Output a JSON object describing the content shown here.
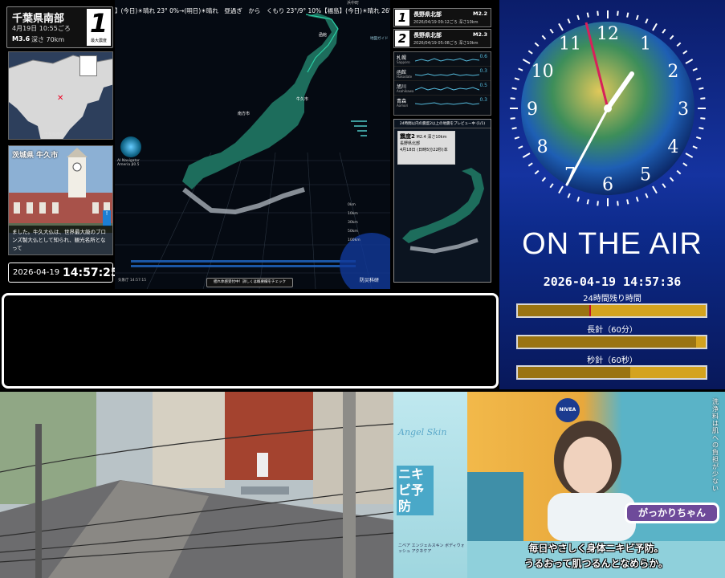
{
  "quake_head": {
    "place": "千葉県南部",
    "time": "4月19日 10:55ごろ",
    "magnitude": "M3.6",
    "depth": "深さ 70km",
    "shindo": "1",
    "shindo_label": "最大震度"
  },
  "mini_map": {
    "label": "千葉県南部"
  },
  "city_card": {
    "title": "茨城県 牛久市",
    "caption": "ました。牛久大仏は、世界最大級のブロンズ製大仏として知られ、観光名所となって"
  },
  "local_clock": {
    "date": "2026-04-19",
    "time": "14:57:25"
  },
  "map": {
    "ticker": "】(今日)☀晴れ 23° 0%→(明日)☀晴れ　昼過ぎ　から　くもり 23°/9° 10%【福島】(今日)☀晴れ 26° 0%",
    "tiny_top": "浜中町",
    "ai_nav": "AI Navigator Ameria β0.5",
    "city_tags": [
      "函館",
      "南方市",
      "牛久市"
    ],
    "depth_scale": [
      "0km",
      "10km",
      "30km",
      "50km",
      "100km"
    ],
    "side_legend": "地図ガイド",
    "note": "揺れ体感受付中！詳しくは概要欄をチェック",
    "hypo_small": "気象庁 14:57:15",
    "bosai": "防災科研"
  },
  "recent": [
    {
      "rank": "1",
      "name": "長野県北部",
      "mag": "M2.2",
      "sub": "2026/04/19 09:12ごろ 深さ10km"
    },
    {
      "rank": "2",
      "name": "長野県北部",
      "mag": "M2.3",
      "sub": "2026/04/19 05:08ごろ 深さ10km"
    }
  ],
  "graphs": [
    {
      "name": "札幌",
      "en": "Sapporo",
      "value": "0.6"
    },
    {
      "name": "函館",
      "en": "Hakodate",
      "value": "0.3"
    },
    {
      "name": "旭川",
      "en": "Asahikawa",
      "value": "0.5"
    },
    {
      "name": "青森",
      "en": "Aomori",
      "value": "0.3"
    }
  ],
  "preview": {
    "header": "24時間以内の震度2以上の地震をプレビュー中 (1/1)",
    "shindo_label": "震度2",
    "mag_depth": "M2.4 深さ10km",
    "place": "長野県北部",
    "time": "4月18日 (日時5分22秒)本"
  },
  "on_air": {
    "title": "ON THE AIR",
    "datetime": "2026-04-19 14:57:36",
    "bars": [
      {
        "label": "24時間残り時間",
        "fraction": 0.38,
        "mark": 0.38
      },
      {
        "label": "長針（60分）",
        "fraction": 0.95,
        "mark": null
      },
      {
        "label": "秒針（60秒）",
        "fraction": 0.6,
        "mark": null
      }
    ],
    "clock_numbers": [
      "12",
      "1",
      "2",
      "3",
      "4",
      "5",
      "6",
      "7",
      "8",
      "9",
      "10",
      "11"
    ]
  },
  "ad": {
    "brand": "Angel Skin",
    "product": "ニキビ予防",
    "nivea": "NIVEA",
    "small": "ニベア エンジェルスキン ボディウォッシュ アクネケア",
    "name_tag": "がっかりちゃん",
    "line1": "毎日やさしく身体ニキビ予防。",
    "line2": "うるおって肌つるんとなめらか。",
    "vertical": "洗浄料は肌への負担が少ない"
  },
  "colors": {
    "panel_blue": "#1533a0",
    "bar_gold": "#d4a31f",
    "accent_teal": "#2bd1a7"
  }
}
